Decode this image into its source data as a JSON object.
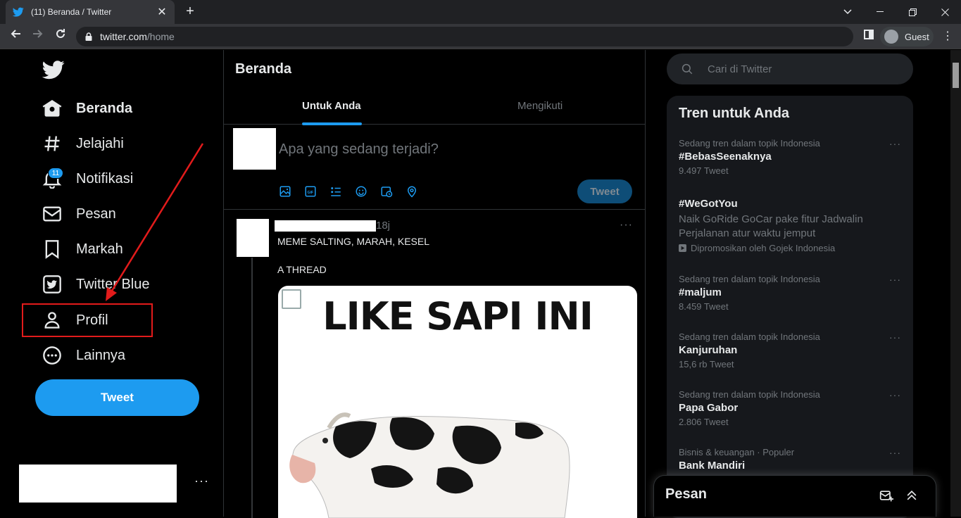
{
  "browser": {
    "tab_title": "(11) Beranda / Twitter",
    "tab_close": "✕",
    "new_tab": "+",
    "url_host": "twitter.com",
    "url_path": "/home",
    "profile_label": "Guest",
    "menu": "⋮"
  },
  "nav": {
    "items": [
      {
        "label": "Beranda",
        "icon": "home-icon"
      },
      {
        "label": "Jelajahi",
        "icon": "hashtag-icon"
      },
      {
        "label": "Notifikasi",
        "icon": "bell-icon"
      },
      {
        "label": "Pesan",
        "icon": "mail-icon"
      },
      {
        "label": "Markah",
        "icon": "bookmark-icon"
      },
      {
        "label": "Twitter Blue",
        "icon": "twitter-blue-icon"
      },
      {
        "label": "Profil",
        "icon": "person-icon"
      },
      {
        "label": "Lainnya",
        "icon": "more-circle-icon"
      }
    ],
    "notification_badge": "11",
    "tweet_button": "Tweet",
    "account_more": "···"
  },
  "center": {
    "title": "Beranda",
    "tabs": [
      "Untuk Anda",
      "Mengikuti"
    ],
    "compose_placeholder": "Apa yang sedang terjadi?",
    "compose_button": "Tweet",
    "post": {
      "time": "18j",
      "more": "···",
      "line1": "MEME SALTING, MARAH, KESEL",
      "line2": "A THREAD",
      "image_text": "LIKE SAPI INI"
    }
  },
  "right": {
    "search_placeholder": "Cari di Twitter",
    "trends_title": "Tren untuk Anda",
    "trends": [
      {
        "context": "Sedang tren dalam topik Indonesia",
        "name": "#BebasSeenaknya",
        "count": "9.497 Tweet"
      },
      {
        "name": "#WeGotYou",
        "description": "Naik GoRide GoCar pake fitur Jadwalin Perjalanan atur waktu jemput",
        "promoted": "Dipromosikan oleh Gojek Indonesia"
      },
      {
        "context": "Sedang tren dalam topik Indonesia",
        "name": "#maljum",
        "count": "8.459 Tweet"
      },
      {
        "context": "Sedang tren dalam topik Indonesia",
        "name": "Kanjuruhan",
        "count": "15,6 rb Tweet"
      },
      {
        "context": "Sedang tren dalam topik Indonesia",
        "name": "Papa Gabor",
        "count": "2.806 Tweet"
      },
      {
        "context": "Bisnis & keuangan · Populer",
        "name": "Bank Mandiri"
      }
    ],
    "more": "···",
    "messages_title": "Pesan"
  },
  "colors": {
    "accent": "#1d9bf0",
    "background": "#000000",
    "highlight": "#e21b1b"
  }
}
